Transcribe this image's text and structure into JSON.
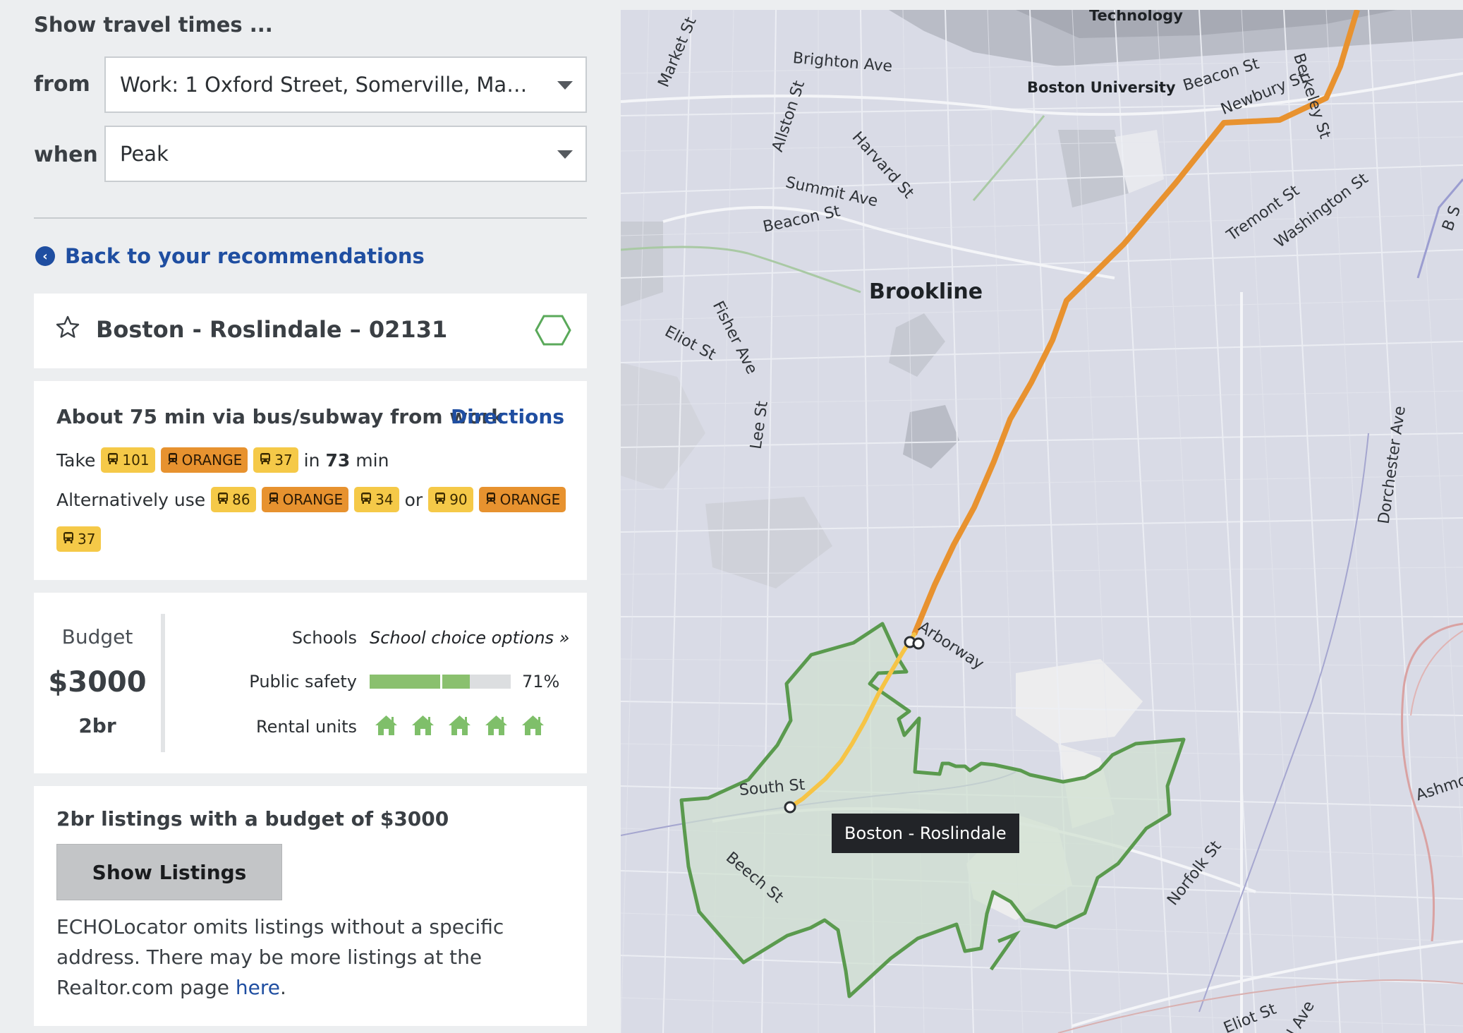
{
  "travel": {
    "title": "Show travel times ...",
    "from_label": "from",
    "from_value": "Work: 1 Oxford Street, Somerville, Massachusetts",
    "when_label": "when",
    "when_value": "Peak"
  },
  "back_link": "Back to your recommendations",
  "neighborhood": {
    "title": "Boston - Roslindale – 02131"
  },
  "commute": {
    "headline": "About 75 min via bus/subway from work",
    "directions_label": "Directions",
    "take_label": "Take",
    "primary_route": [
      {
        "mode": "bus",
        "label": "101"
      },
      {
        "mode": "subway",
        "label": "ORANGE"
      },
      {
        "mode": "bus",
        "label": "37"
      }
    ],
    "in_label": "in",
    "duration": "73",
    "duration_unit": "min",
    "alt_label": "Alternatively use",
    "alt_route_1": [
      {
        "mode": "bus",
        "label": "86"
      },
      {
        "mode": "subway",
        "label": "ORANGE"
      },
      {
        "mode": "bus",
        "label": "34"
      }
    ],
    "or_label": "or",
    "alt_route_2": [
      {
        "mode": "bus",
        "label": "90"
      },
      {
        "mode": "subway",
        "label": "ORANGE"
      },
      {
        "mode": "bus",
        "label": "37"
      }
    ]
  },
  "budget": {
    "label": "Budget",
    "value": "$3000",
    "bedrooms": "2br",
    "schools_label": "Schools",
    "schools_link": "School choice options »",
    "safety_label": "Public safety",
    "safety_percent": 71,
    "safety_text": "71%",
    "rental_label": "Rental units",
    "rental_level": 5
  },
  "listings": {
    "headline": "2br listings with a budget of $3000",
    "button_label": "Show Listings",
    "note": "ECHOLocator omits listings without a specific address. There may be more listings at the Realtor.com page",
    "link_text": "here",
    "note_end": "."
  },
  "map": {
    "tooltip": "Boston - Roslindale",
    "labels": {
      "technology": "Technology",
      "brighton_ave": "Brighton Ave",
      "market_st": "Market St",
      "boston_university": "Boston University",
      "beacon_st_ne": "Beacon St",
      "newbury_st": "Newbury St",
      "berkeley_st": "Berkeley St",
      "allston_st": "Allston St",
      "harvard_st": "Harvard St",
      "summit_ave": "Summit Ave",
      "beacon_st": "Beacon St",
      "tremont_st": "Tremont St",
      "washington_st": "Washington St",
      "brookline": "Brookline",
      "fisher_ave": "Fisher Ave",
      "eliot_st": "Eliot St",
      "lee_st": "Lee St",
      "dorchester_ave": "Dorchester Ave",
      "arborway": "Arborway",
      "south_st": "South St",
      "beech_st": "Beech St",
      "norfolk_st": "Norfolk St",
      "ashmont": "Ashmo",
      "eliot_st_se": "Eliot St",
      "central_ave": "ral Ave",
      "b_st": "B S"
    },
    "colors": {
      "orange_line": "#e8922f",
      "selected_route": "#f6c445",
      "neighborhood_outline": "#5a9a4e",
      "neighborhood_fill": "#cfe0cf"
    }
  },
  "colors": {
    "link": "#1f4ea1",
    "bus_badge": "#f5c948",
    "subway_badge": "#e7922f",
    "safety_fill": "#8ac06e"
  }
}
